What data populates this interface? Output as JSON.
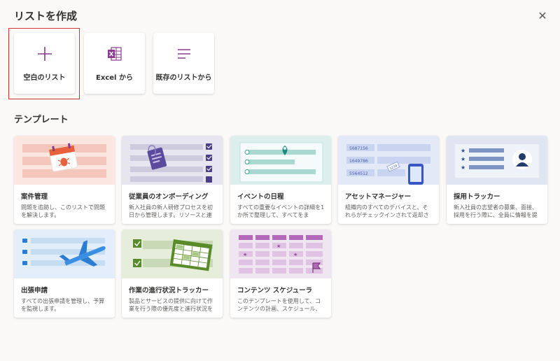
{
  "dialog": {
    "title": "リストを作成",
    "close_icon": "close-icon",
    "section_title": "テンプレート"
  },
  "options": [
    {
      "label": "空白のリスト",
      "icon": "plus-icon",
      "selected": true
    },
    {
      "label": "Excel から",
      "icon": "excel-icon"
    },
    {
      "label": "既存のリストから",
      "icon": "list-icon"
    }
  ],
  "templates": [
    {
      "title": "案件管理",
      "desc": "問題を追跡し、このリストで問題を解決します。",
      "thumb_bg": "#fbe6e2"
    },
    {
      "title": "従業員のオンボーディング",
      "desc": "新入社員の新人研修プロセスを初日から管理します。リソースと連",
      "thumb_bg": "#e7e5ef"
    },
    {
      "title": "イベントの日程",
      "desc": "すべての重要なイベントの詳細を1か所で整理して、すべてをま",
      "thumb_bg": "#dcefec"
    },
    {
      "title": "アセットマネージャー",
      "desc": "組織内のすべてのデバイスと、それらがチェックインされて返却さ",
      "thumb_bg": "#e3e9f7"
    },
    {
      "title": "採用トラッカー",
      "desc": "新入社員の志望者の募集、面接、採用を行う際に、全員に情報を提",
      "thumb_bg": "#dfe6f1"
    },
    {
      "title": "出張申請",
      "desc": "すべての出張申請を管理し、予算を監視します。",
      "thumb_bg": "#e3eefa"
    },
    {
      "title": "作業の進行状況トラッカー",
      "desc": "製品とサービスの提供に向けて作業を行う際の優先度と進行状況を",
      "thumb_bg": "#e6eedb"
    },
    {
      "title": "コンテンツ スケジューラ",
      "desc": "このテンプレートを使用して、コンテンツの計画、スケジュール、",
      "thumb_bg": "#f0e6f2"
    }
  ],
  "colors": {
    "accent_purple": "#8a3a8f",
    "excel_green": "#217346",
    "selection_red": "#d13438"
  }
}
